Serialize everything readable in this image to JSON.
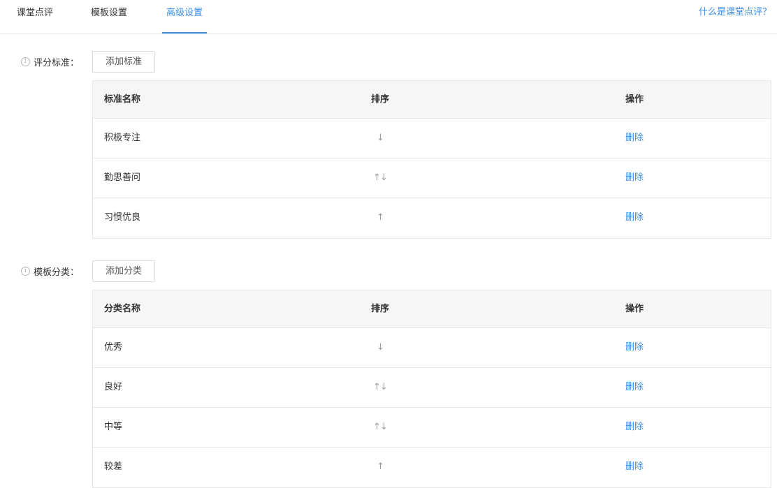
{
  "tabs": [
    {
      "label": "课堂点评",
      "active": false
    },
    {
      "label": "模板设置",
      "active": false
    },
    {
      "label": "高级设置",
      "active": true
    }
  ],
  "help_link": "什么是课堂点评？",
  "colors": {
    "accent": "#3a8ee6",
    "header_bg": "#f5f6f8",
    "border": "#e6e6e6"
  },
  "criteria": {
    "label": "评分标准：",
    "add_button": "添加标准",
    "headers": {
      "name": "标准名称",
      "sort": "排序",
      "action": "操作"
    },
    "rows": [
      {
        "name": "积极专注",
        "up": "",
        "down": "↓",
        "delete": "删除"
      },
      {
        "name": "勤思善问",
        "up": "↑",
        "down": "↓",
        "delete": "删除"
      },
      {
        "name": "习惯优良",
        "up": "↑",
        "down": "",
        "delete": "删除"
      }
    ]
  },
  "categories": {
    "label": "模板分类：",
    "add_button": "添加分类",
    "headers": {
      "name": "分类名称",
      "sort": "排序",
      "action": "操作"
    },
    "rows": [
      {
        "name": "优秀",
        "up": "",
        "down": "↓",
        "delete": "删除"
      },
      {
        "name": "良好",
        "up": "↑",
        "down": "↓",
        "delete": "删除"
      },
      {
        "name": "中等",
        "up": "↑",
        "down": "↓",
        "delete": "删除"
      },
      {
        "name": "较差",
        "up": "↑",
        "down": "",
        "delete": "删除"
      }
    ]
  },
  "icons": {
    "info": "info-circle-icon",
    "up": "arrow-up-icon",
    "down": "arrow-down-icon"
  }
}
